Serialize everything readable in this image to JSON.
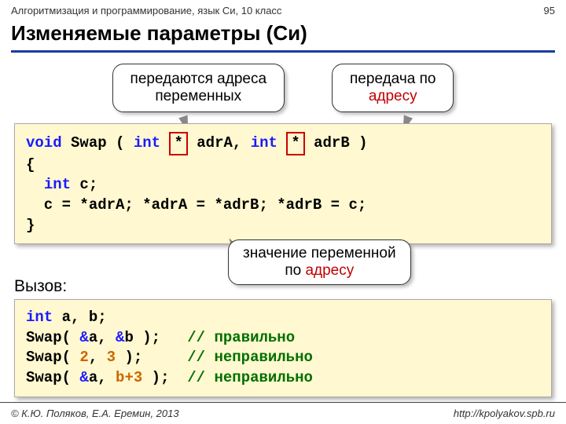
{
  "header": {
    "left": "Алгоритмизация и программирование, язык Си, 10 класс",
    "right": "95"
  },
  "title": "Изменяемые параметры (Си)",
  "callout1_line1": "передаются адреса",
  "callout1_line2": "переменных",
  "callout2_line1": "передача по",
  "callout2_word": "адресу",
  "code1": {
    "l1a": "void",
    "l1b": " Swap ( ",
    "l1c": "int",
    "l1d": " ",
    "l1star1": "*",
    "l1e": " adrA, ",
    "l1f": "int",
    "l1g": " ",
    "l1star2": "*",
    "l1h": " adrB )",
    "l2": "{",
    "l3a": "  ",
    "l3b": "int",
    "l3c": " c;",
    "l4": "  c = *adrA; *adrA = *adrB; *adrB = c;",
    "l5": "}"
  },
  "mid_callout_l1": "значение переменной",
  "mid_callout_l2a": "по ",
  "mid_callout_l2b": "адресу",
  "subheading": "Вызов:",
  "code2": {
    "l1a": "int",
    "l1b": " a, b;",
    "l2a": "Swap( ",
    "l2b": "&",
    "l2c": "a, ",
    "l2d": "&",
    "l2e": "b );   ",
    "l2f": "// правильно",
    "l3a": "Swap( ",
    "l3b": "2",
    "l3c": ", ",
    "l3d": "3",
    "l3e": " );     ",
    "l3f": "// неправильно",
    "l4a": "Swap( ",
    "l4b": "&",
    "l4c": "a, ",
    "l4d": "b+3",
    "l4e": " );  ",
    "l4f": "// неправильно"
  },
  "footer": {
    "left": "© К.Ю. Поляков, Е.А. Еремин, 2013",
    "right": "http://kpolyakov.spb.ru"
  }
}
